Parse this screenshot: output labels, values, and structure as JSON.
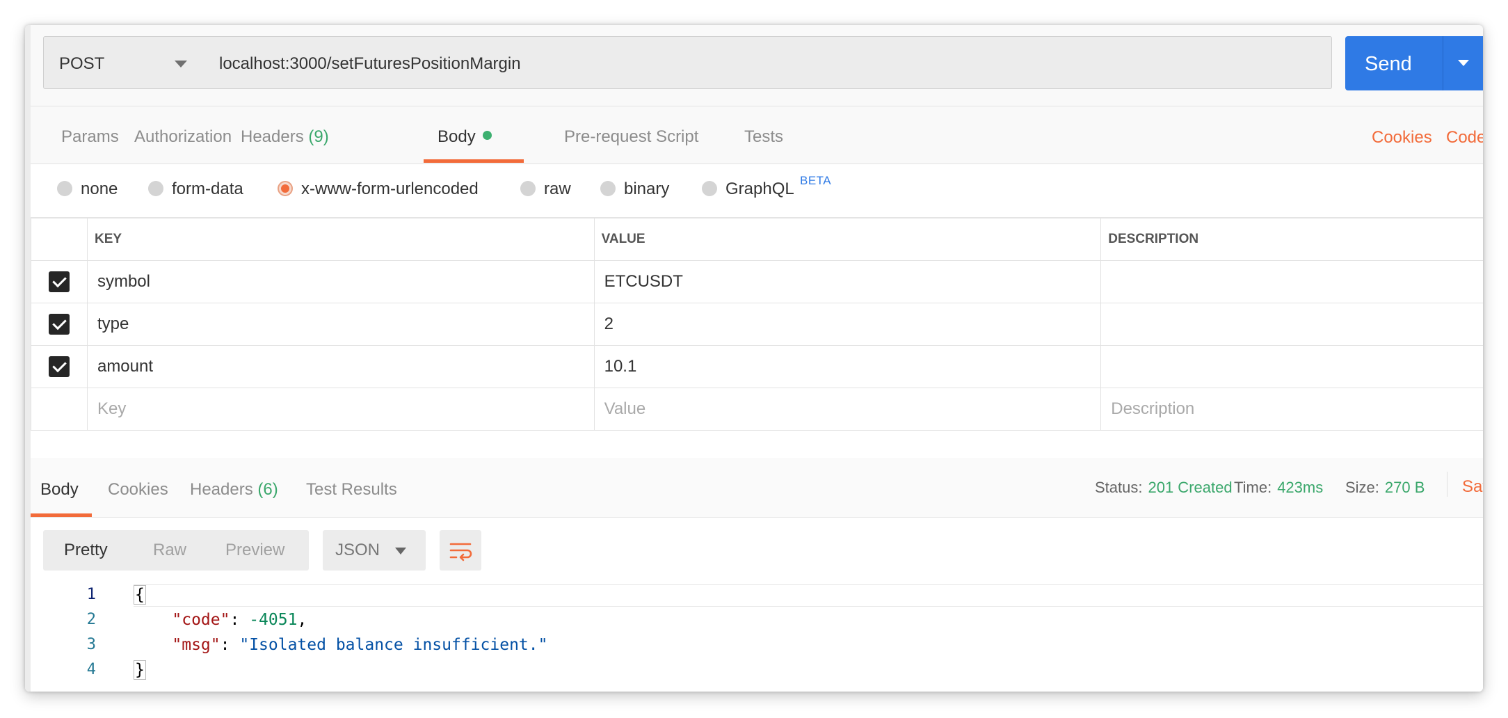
{
  "request": {
    "method": "POST",
    "url": "localhost:3000/setFuturesPositionMargin",
    "send_label": "Send"
  },
  "request_tabs": {
    "params": "Params",
    "authorization": "Authorization",
    "headers": "Headers",
    "headers_count": "(9)",
    "body": "Body",
    "pre_request": "Pre-request Script",
    "tests": "Tests",
    "cookies": "Cookies",
    "code": "Code"
  },
  "body_types": {
    "none": "none",
    "form_data": "form-data",
    "urlencoded": "x-www-form-urlencoded",
    "raw": "raw",
    "binary": "binary",
    "graphql": "GraphQL",
    "beta": "BETA",
    "selected": "x-www-form-urlencoded"
  },
  "params_table": {
    "headers": {
      "key": "KEY",
      "value": "VALUE",
      "description": "DESCRIPTION"
    },
    "rows": [
      {
        "checked": true,
        "key": "symbol",
        "value": "ETCUSDT",
        "description": ""
      },
      {
        "checked": true,
        "key": "type",
        "value": "2",
        "description": ""
      },
      {
        "checked": true,
        "key": "amount",
        "value": "10.1",
        "description": ""
      }
    ],
    "placeholders": {
      "key": "Key",
      "value": "Value",
      "description": "Description"
    }
  },
  "response": {
    "tabs": {
      "body": "Body",
      "cookies": "Cookies",
      "headers": "Headers",
      "headers_count": "(6)",
      "test_results": "Test Results"
    },
    "status_label": "Status:",
    "status_value": "201 Created",
    "time_label": "Time:",
    "time_value": "423ms",
    "size_label": "Size:",
    "size_value": "270 B",
    "save_label": "Sav",
    "view_modes": {
      "pretty": "Pretty",
      "raw": "Raw",
      "preview": "Preview"
    },
    "format": "JSON",
    "wrap_icon": "wrap-lines-icon",
    "code": {
      "line_numbers": [
        "1",
        "2",
        "3",
        "4"
      ],
      "open_brace": "{",
      "close_brace": "}",
      "code_key": "\"code\"",
      "code_value": "-4051",
      "msg_key": "\"msg\"",
      "msg_value": "\"Isolated balance insufficient.\""
    }
  },
  "colors": {
    "accent": "#f26b3a",
    "send": "#2f7ae5",
    "success": "#3aa76b"
  }
}
